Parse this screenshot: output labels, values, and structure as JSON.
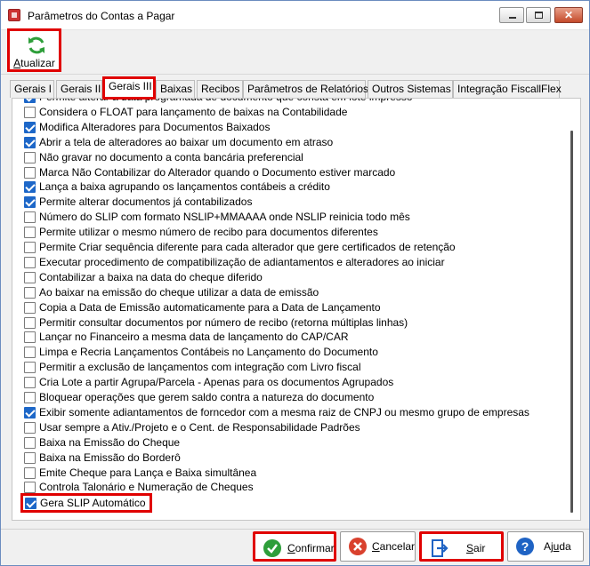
{
  "window": {
    "title": "Parâmetros do Contas a Pagar"
  },
  "toolbar": {
    "refresh_label": "Atualizar",
    "refresh_underline": "A",
    "refresh_rest": "tualizar"
  },
  "tabs": [
    {
      "label": "Gerais I",
      "active": false
    },
    {
      "label": "Gerais II",
      "active": false
    },
    {
      "label": "Gerais III",
      "active": true
    },
    {
      "label": "Baixas",
      "active": false
    },
    {
      "label": "Recibos",
      "active": false
    },
    {
      "label": "Parâmetros de Relatórios",
      "active": false
    },
    {
      "label": "Outros Sistemas",
      "active": false
    },
    {
      "label": "Integração FiscallFlex",
      "active": false
    }
  ],
  "options": [
    {
      "label": "Permite alterar a data programada de documento que consta em lote impresso",
      "checked": true
    },
    {
      "label": "Considera o FLOAT para lançamento de baixas na Contabilidade",
      "checked": false
    },
    {
      "label": "Modifica Alteradores para Documentos Baixados",
      "checked": true
    },
    {
      "label": "Abrir a tela de alteradores ao baixar um documento em atraso",
      "checked": true
    },
    {
      "label": "Não gravar no documento a conta bancária preferencial",
      "checked": false
    },
    {
      "label": "Marca Não Contabilizar do Alterador quando o Documento estiver marcado",
      "checked": false
    },
    {
      "label": "Lança a baixa agrupando os lançamentos contábeis a crédito",
      "checked": true
    },
    {
      "label": "Permite alterar documentos já contabilizados",
      "checked": true
    },
    {
      "label": "Número do SLIP com formato NSLIP+MMAAAA onde NSLIP reinicia todo mês",
      "checked": false
    },
    {
      "label": "Permite utilizar o mesmo número de recibo para documentos diferentes",
      "checked": false
    },
    {
      "label": "Permite Criar sequência diferente para cada alterador que gere certificados de retenção",
      "checked": false
    },
    {
      "label": "Executar procedimento de compatibilização de adiantamentos e alteradores ao iniciar",
      "checked": false
    },
    {
      "label": "Contabilizar a baixa na data do cheque diferido",
      "checked": false
    },
    {
      "label": "Ao baixar na emissão do cheque utilizar a data de emissão",
      "checked": false
    },
    {
      "label": "Copia a Data de Emissão automaticamente para a Data de Lançamento",
      "checked": false
    },
    {
      "label": "Permitir consultar documentos por número de recibo (retorna múltiplas linhas)",
      "checked": false
    },
    {
      "label": "Lançar no Financeiro a mesma data de lançamento do CAP/CAR",
      "checked": false
    },
    {
      "label": "Limpa e Recria Lançamentos Contábeis no Lançamento do Documento",
      "checked": false
    },
    {
      "label": "Permitir a exclusão de lançamentos com integração com Livro fiscal",
      "checked": false
    },
    {
      "label": "Cria Lote a partir Agrupa/Parcela - Apenas para os documentos Agrupados",
      "checked": false
    },
    {
      "label": "Bloquear operações que gerem saldo contra a natureza do documento",
      "checked": false
    },
    {
      "label": "Exibir somente adiantamentos de forncedor com a mesma raiz de CNPJ ou mesmo grupo de empresas",
      "checked": true
    },
    {
      "label": "Usar sempre a Ativ./Projeto e o Cent. de Responsabilidade Padrões",
      "checked": false
    },
    {
      "label": "Baixa na Emissão do Cheque",
      "checked": false
    },
    {
      "label": "Baixa na Emissão do Borderô",
      "checked": false
    },
    {
      "label": "Emite Cheque para Lança e Baixa simultânea",
      "checked": false
    },
    {
      "label": "Controla Talonário e Numeração de Cheques",
      "checked": false
    },
    {
      "label": "Gera SLIP Automático",
      "checked": true
    }
  ],
  "buttons": {
    "confirm": {
      "u": "C",
      "rest": "onfirmar"
    },
    "cancel": {
      "u": "C",
      "rest": "ancelar"
    },
    "exit": {
      "u": "S",
      "rest": "air"
    },
    "help": {
      "pre": "Aj",
      "u": "u",
      "rest": "da"
    }
  },
  "colors": {
    "highlight": "#e00000",
    "checkbox_on": "#1d67c8",
    "confirm_icon": "#2e9e3a",
    "cancel_icon": "#d9412e",
    "help_icon": "#1f63c4"
  }
}
